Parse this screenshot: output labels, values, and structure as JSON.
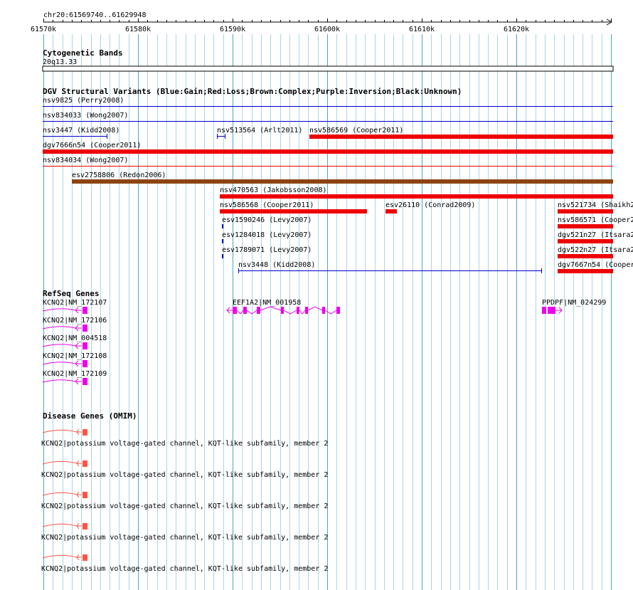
{
  "ruler": {
    "region": "chr20:61569740..61629948",
    "ticks": [
      "61570k",
      "61580k",
      "61590k",
      "61600k",
      "61610k",
      "61620k"
    ]
  },
  "cytobands": {
    "title": "Cytogenetic Bands",
    "band": "20q13.33"
  },
  "dgv": {
    "title": "DGV Structural Variants (Blue:Gain;Red:Loss;Brown:Complex;Purple:Inversion;Black:Unknown)",
    "colors": {
      "gain": "#0000cc",
      "loss": "#ee0000",
      "complex": "#8b4513"
    },
    "labels": [
      "nsv9825 (Perry2008)",
      "nsv834033 (Wong2007)",
      "nsv3447 (Kidd2008)",
      "nsv513564 (Arlt2011)",
      "nsv586569 (Cooper2011)",
      "dgv7666n54 (Cooper2011)",
      "nsv834034 (Wong2007)",
      "esv2758806 (Redon2006)",
      "nsv470563 (Jakobsson2008)",
      "nsv586568 (Cooper2011)",
      "esv26110 (Conrad2009)",
      "nsv521734 (Shaikh2",
      "esv1590246 (Levy2007)",
      "nsv586571 (Cooper2",
      "esv1284018 (Levy2007)",
      "dgv521n27 (Itsara2",
      "esv1789071 (Levy2007)",
      "dgv522n27 (Itsara2",
      "nsv3448 (Kidd2008)",
      "dgv7667n54 (Cooper"
    ]
  },
  "refseq": {
    "title": "RefSeq Genes",
    "color": "#ee00ee",
    "labels": [
      "KCNQ2|NM_172107",
      "EEF1A2|NM_001958",
      "PPDPF|NM_024299",
      "KCNQ2|NM_172106",
      "KCNQ2|NM_004518",
      "KCNQ2|NM_172108",
      "KCNQ2|NM_172109"
    ]
  },
  "omim": {
    "title": "Disease Genes (OMIM)",
    "color": "#ff5544",
    "labels": [
      "KCNQ2|potassium voltage-gated channel, KQT-like subfamily, member 2",
      "KCNQ2|potassium voltage-gated channel, KQT-like subfamily, member 2",
      "KCNQ2|potassium voltage-gated channel, KQT-like subfamily, member 2",
      "KCNQ2|potassium voltage-gated channel, KQT-like subfamily, member 2",
      "KCNQ2|potassium voltage-gated channel, KQT-like subfamily, member 2"
    ]
  }
}
